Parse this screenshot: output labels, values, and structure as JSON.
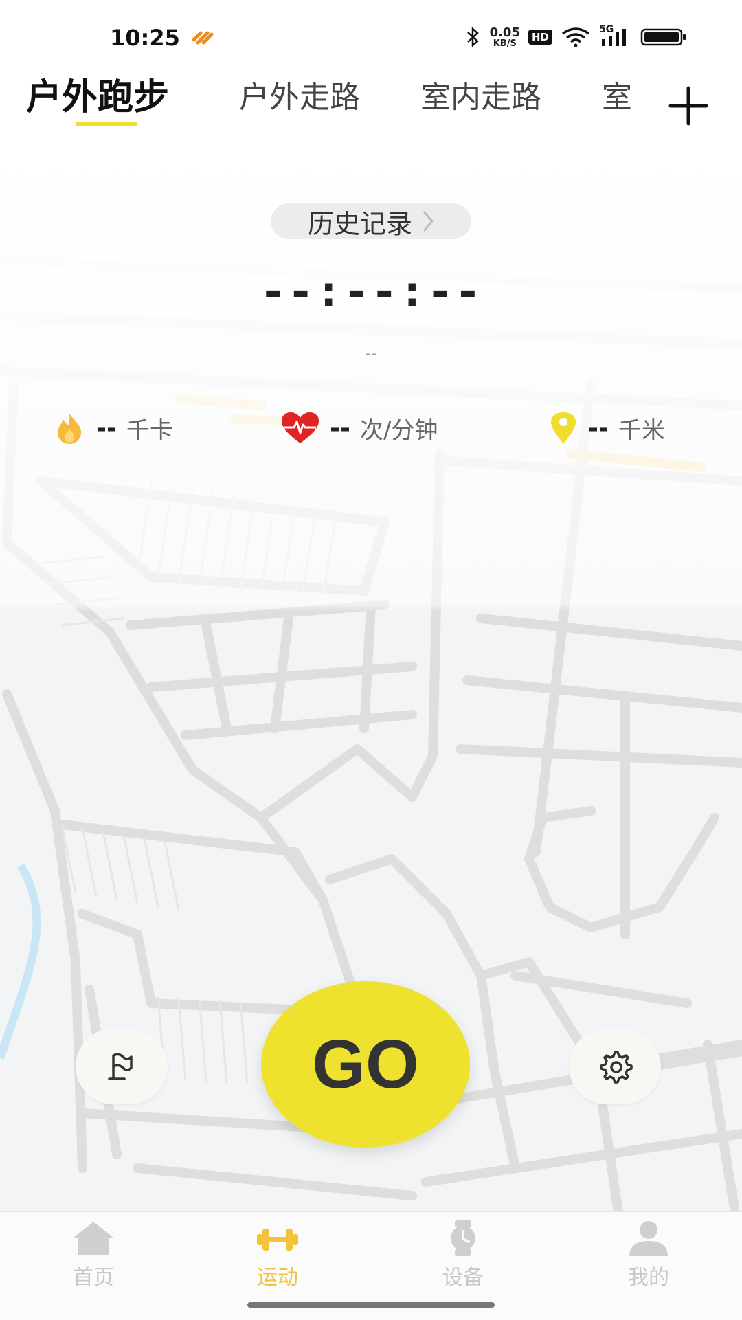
{
  "status_bar": {
    "time": "10:25",
    "net_speed_value": "0.05",
    "net_speed_unit": "KB/S",
    "hd_badge": "HD",
    "network": "5G"
  },
  "tabs": [
    {
      "label": "户外跑步",
      "active": true
    },
    {
      "label": "户外走路",
      "active": false
    },
    {
      "label": "室内走路",
      "active": false
    },
    {
      "label": "室",
      "active": false
    }
  ],
  "history_label": "历史记录",
  "timer": "--:--:--",
  "timer_sub": "--",
  "stats": {
    "calories": {
      "value": "--",
      "unit": "千卡"
    },
    "heart_rate": {
      "value": "--",
      "unit": "次/分钟"
    },
    "distance": {
      "value": "--",
      "unit": "千米"
    }
  },
  "go_label": "GO",
  "bottom_nav": [
    {
      "label": "首页",
      "icon": "home-icon",
      "active": false
    },
    {
      "label": "运动",
      "icon": "dumbbell-icon",
      "active": true
    },
    {
      "label": "设备",
      "icon": "watch-icon",
      "active": false
    },
    {
      "label": "我的",
      "icon": "person-icon",
      "active": false
    }
  ],
  "colors": {
    "accent_yellow": "#eee22f",
    "active_nav": "#f4c33e",
    "heart_red": "#e02424",
    "fire_orange": "#f7b93a",
    "pin_yellow": "#f0dc2b"
  }
}
